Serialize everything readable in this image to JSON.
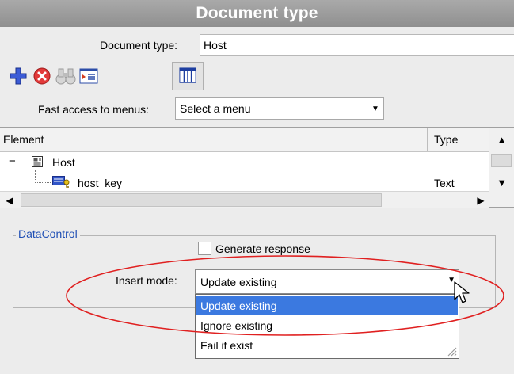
{
  "window": {
    "title": "Document type"
  },
  "document_type": {
    "label": "Document type:",
    "value": "Host"
  },
  "toolbar": {
    "icons": [
      "plus-icon",
      "close-circle-icon",
      "binoculars-icon",
      "list-window-icon",
      "grid-icon"
    ]
  },
  "fast_access": {
    "label": "Fast access to menus:",
    "selected": "Select a menu"
  },
  "grid": {
    "columns": [
      "Element",
      "Type"
    ],
    "rows": [
      {
        "expander": "−",
        "element": "Host",
        "type": ""
      },
      {
        "element": "host_key",
        "type": "Text"
      }
    ]
  },
  "data_control": {
    "title": "DataControl",
    "generate_response_label": "Generate response",
    "generate_response_checked": false,
    "insert_mode_label": "Insert mode:",
    "insert_mode_selected": "Update existing",
    "options": [
      "Update existing",
      "Ignore existing",
      "Fail if exist"
    ]
  },
  "colors": {
    "selection": "#3b79e0",
    "annotation": "#e02020",
    "group_title": "#1f4fb5"
  }
}
